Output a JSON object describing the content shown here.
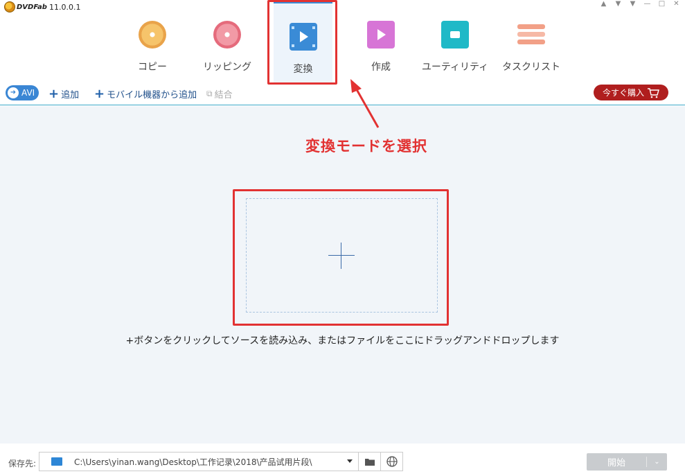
{
  "app": {
    "logo_text": "DVDFab",
    "version": "11.0.0.1"
  },
  "window_controls": [
    "pin-icon",
    "shirt-icon",
    "dropdown-icon",
    "minimize-icon",
    "maximize-icon",
    "close-icon"
  ],
  "tabs": [
    {
      "label": "コピー",
      "icon": "copy-disc-icon",
      "active": false
    },
    {
      "label": "リッピング",
      "icon": "ripper-disc-icon",
      "active": false
    },
    {
      "label": "変換",
      "icon": "converter-film-icon",
      "active": true
    },
    {
      "label": "作成",
      "icon": "creator-film-icon",
      "active": false
    },
    {
      "label": "ユーティリティ",
      "icon": "utility-folder-icon",
      "active": false
    },
    {
      "label": "タスクリスト",
      "icon": "task-list-icon",
      "active": false
    }
  ],
  "toolbar": {
    "format_button": "AVI",
    "add_label": "追加",
    "add_mobile_label": "モバイル機器から追加",
    "merge_label": "結合",
    "buy_label": "今すぐ購入"
  },
  "annotation": {
    "text": "変換モードを選択"
  },
  "drop_zone": {
    "hint": "+ボタンをクリックしてソースを読み込み、またはファイルをここにドラッグアンドドロップします"
  },
  "bottom": {
    "save_label": "保存先:",
    "output_path": "C:\\Users\\yinan.wang\\Desktop\\工作记录\\2018\\产品试用片段\\",
    "start_label": "開始"
  },
  "colors": {
    "accent": "#3a86d4",
    "highlight": "#e23232",
    "buy": "#b01e1e",
    "main_bg": "#f1f5f9"
  }
}
